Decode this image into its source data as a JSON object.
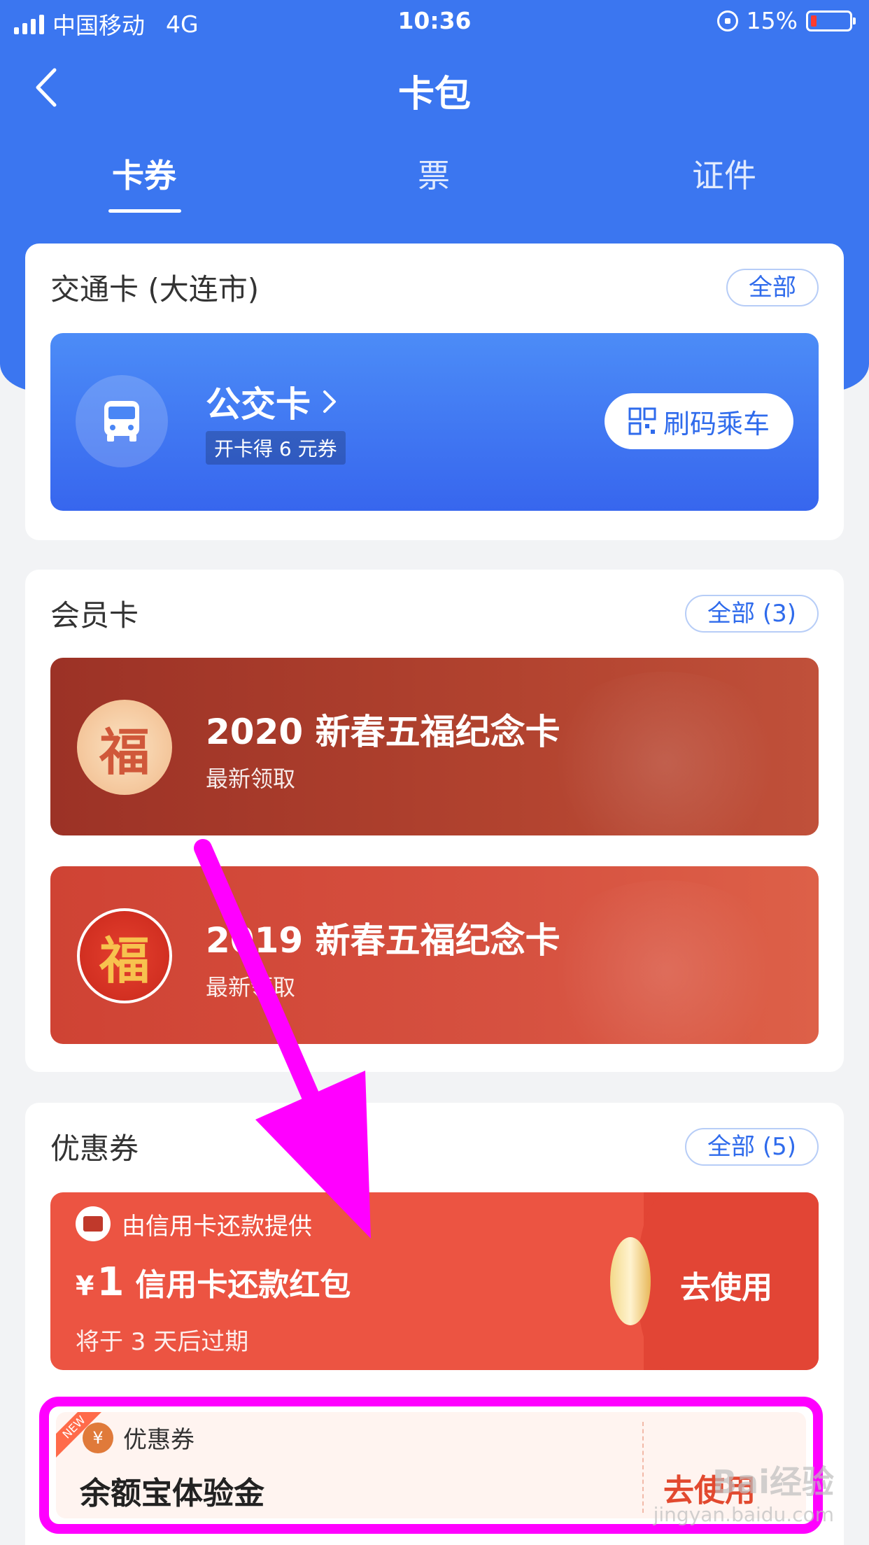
{
  "status_bar": {
    "carrier": "中国移动",
    "network": "4G",
    "time": "10:36",
    "battery": "15%"
  },
  "nav": {
    "title": "卡包"
  },
  "tabs": [
    {
      "label": "卡券",
      "active": true
    },
    {
      "label": "票",
      "active": false
    },
    {
      "label": "证件",
      "active": false
    }
  ],
  "transit": {
    "title": "交通卡 (大连市)",
    "all_label": "全部",
    "card_name": "公交卡",
    "tag": "开卡得 6 元券",
    "scan_label": "刷码乘车"
  },
  "membership": {
    "title": "会员卡",
    "all_label": "全部 (3)",
    "cards": [
      {
        "name": "2020 新春五福纪念卡",
        "sub": "最新领取",
        "logo": "福",
        "bg": "#a83a2c"
      },
      {
        "name": "2019 新春五福纪念卡",
        "sub": "最新领取",
        "logo": "福",
        "bg": "#d4493a"
      }
    ]
  },
  "coupons": {
    "title": "优惠券",
    "all_label": "全部 (5)",
    "red": {
      "provider": "由信用卡还款提供",
      "currency": "¥",
      "amount": "1",
      "name": "信用卡还款红包",
      "expire": "将于 3 天后过期",
      "use_label": "去使用"
    },
    "yeb": {
      "badge": "NEW",
      "type_label": "优惠券",
      "icon": "¥",
      "name": "余额宝体验金",
      "use_label": "去使用"
    }
  },
  "watermark": {
    "text": "Bai经验",
    "url": "jingyan.baidu.com"
  },
  "colors": {
    "primary": "#3b76f0",
    "annotation": "#ff00ff",
    "coupon_red": "#ec5442"
  }
}
